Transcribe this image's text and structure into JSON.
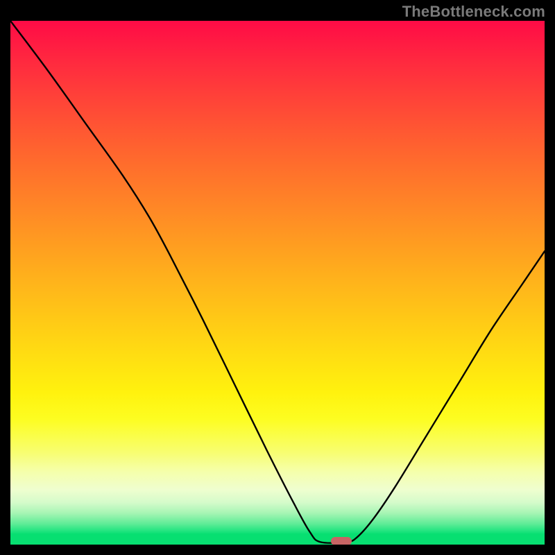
{
  "watermark": "TheBottleneck.com",
  "marker": {
    "x_pct": 62,
    "y_pct": 99.3,
    "color": "#c86464"
  },
  "chart_data": {
    "type": "line",
    "title": "",
    "xlabel": "",
    "ylabel": "",
    "xlim": [
      0,
      100
    ],
    "ylim": [
      0,
      100
    ],
    "grid": false,
    "legend": false,
    "background": "rainbow-vertical-gradient",
    "series": [
      {
        "name": "bottleneck-curve",
        "stroke": "#000000",
        "stroke_width": 2.4,
        "points": [
          {
            "x": 0,
            "y": 100
          },
          {
            "x": 7,
            "y": 90.5
          },
          {
            "x": 14,
            "y": 80.5
          },
          {
            "x": 21,
            "y": 70.5
          },
          {
            "x": 26,
            "y": 62.5
          },
          {
            "x": 30,
            "y": 55
          },
          {
            "x": 36,
            "y": 43
          },
          {
            "x": 42,
            "y": 30.5
          },
          {
            "x": 48,
            "y": 18
          },
          {
            "x": 53,
            "y": 8
          },
          {
            "x": 56,
            "y": 2.5
          },
          {
            "x": 58,
            "y": 0.5
          },
          {
            "x": 63,
            "y": 0.5
          },
          {
            "x": 65,
            "y": 1.5
          },
          {
            "x": 68,
            "y": 5
          },
          {
            "x": 72,
            "y": 11
          },
          {
            "x": 78,
            "y": 21
          },
          {
            "x": 84,
            "y": 31
          },
          {
            "x": 90,
            "y": 41
          },
          {
            "x": 96,
            "y": 50
          },
          {
            "x": 100,
            "y": 56
          }
        ]
      }
    ]
  }
}
